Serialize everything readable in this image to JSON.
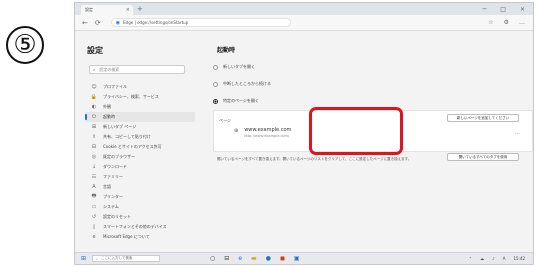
{
  "step_number": "⑤",
  "browser": {
    "tab_label": "設定",
    "tab_close": "×",
    "new_tab": "+",
    "window_controls": [
      "─",
      "□",
      "×"
    ],
    "nav": {
      "back": "←",
      "refresh": "⟳"
    },
    "url": "Edge | edge://settings/onStartup",
    "toolbar_icons": [
      "☆",
      "⚙",
      "…"
    ]
  },
  "sidebar": {
    "title": "設定",
    "search_placeholder": "設定の検索",
    "items": [
      {
        "icon": "☺",
        "label": "プロファイル"
      },
      {
        "icon": "🔒",
        "label": "プライバシー、検索、サービス"
      },
      {
        "icon": "◐",
        "label": "外観"
      },
      {
        "icon": "⏻",
        "label": "起動時",
        "active": true
      },
      {
        "icon": "⊞",
        "label": "新しいタブ ページ"
      },
      {
        "icon": "⇪",
        "label": "共有、コピーして貼り付け"
      },
      {
        "icon": "⊟",
        "label": "Cookie とサイトのアクセス許可"
      },
      {
        "icon": "◎",
        "label": "既定のブラウザー"
      },
      {
        "icon": "↓",
        "label": "ダウンロード"
      },
      {
        "icon": "☷",
        "label": "ファミリー"
      },
      {
        "icon": "A",
        "label": "言語"
      },
      {
        "icon": "🖶",
        "label": "プリンター"
      },
      {
        "icon": "▭",
        "label": "システム"
      },
      {
        "icon": "↺",
        "label": "設定のリセット"
      },
      {
        "icon": "▯",
        "label": "スマートフォンとその他のデバイス"
      },
      {
        "icon": "e",
        "label": "Microsoft Edge について"
      }
    ]
  },
  "main": {
    "title": "起動時",
    "options": [
      {
        "label": "新しいタブを開く",
        "selected": false
      },
      {
        "label": "中断したところから続ける",
        "selected": false
      },
      {
        "label": "特定のページを開く",
        "selected": true
      }
    ],
    "card_label": "ページ",
    "page_title": "www.example.com",
    "page_url": "http://www.example.com/",
    "more_icon": "…",
    "add_page_button": "新しいページを追加してください",
    "use_open_tabs_button": "開いているすべてのタブを使用",
    "note": "開いているページをすべて置き換えます。開いているページのリストをクリアして、ここに設定したページに置き換えます。"
  },
  "taskbar": {
    "start_icon": "⊞",
    "search_placeholder": "ここに入力して検索",
    "apps": [
      "○",
      "⊟",
      "e",
      "▬",
      "●",
      "◼",
      "▣"
    ],
    "tray_icons": [
      "⌃",
      "☁",
      "♪",
      "A"
    ],
    "clock": "15:42"
  }
}
